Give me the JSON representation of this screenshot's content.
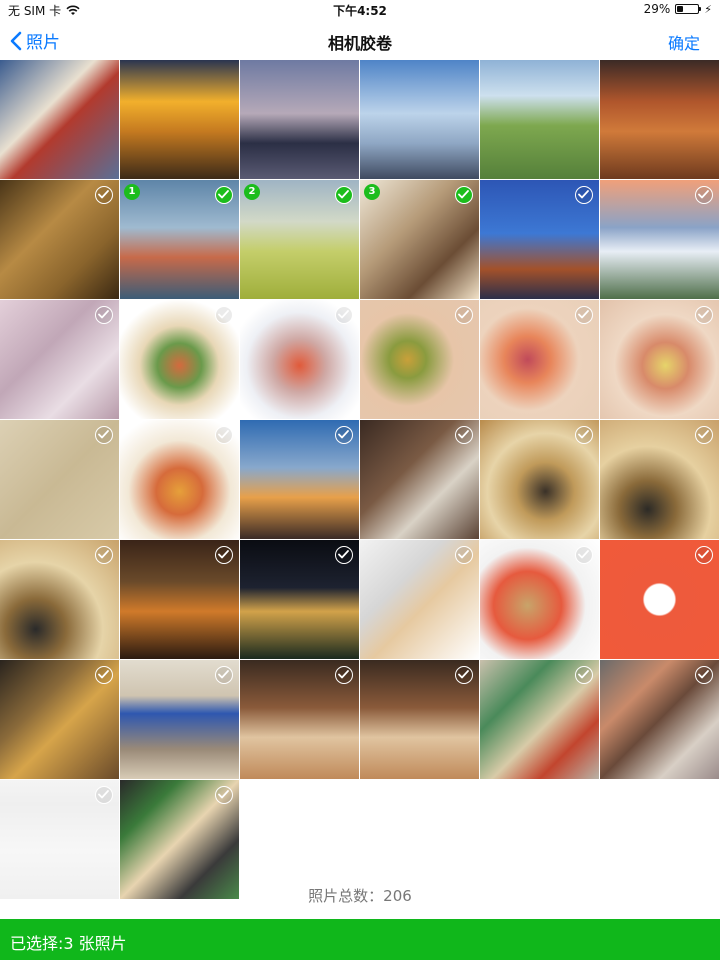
{
  "status": {
    "carrier": "无 SIM 卡",
    "time": "下午4:52",
    "battery": "29%",
    "battery_level": 0.29
  },
  "nav": {
    "back_label": "照片",
    "title": "相机胶卷",
    "confirm_label": "确定"
  },
  "summary": {
    "total_text": "照片总数：206"
  },
  "footer": {
    "selected_text": "已选择:3 张照片"
  },
  "selection": {
    "selected_color": "#1cbd1c",
    "accent_color": "#0a7aff"
  },
  "photos": [
    {
      "bg": "linear-gradient(135deg,#3b5c8f 0%,#e9e0d0 40%,#b23a2e 55%,#5a6f96 100%)",
      "check": false
    },
    {
      "bg": "linear-gradient(180deg,#2a3550 0%,#f2b02c 35%,#c57a20 60%,#3c2a18 100%)",
      "check": false
    },
    {
      "bg": "linear-gradient(180deg,#6e7aa2 0%,#b6a9b8 45%,#2b2f45 70%,#5a5a73 100%)",
      "check": false
    },
    {
      "bg": "linear-gradient(180deg,#4f84c7 0%,#bcd3ea 45%,#8fa7c4 70%,#3f4a60 100%)",
      "check": false
    },
    {
      "bg": "linear-gradient(180deg,#8fb2d6 0%,#cde0ee 30%,#7ea84f 55%,#55803a 100%)",
      "check": false
    },
    {
      "bg": "linear-gradient(180deg,#3b2a26 0%,#b0562c 35%,#d07a3a 60%,#6e3a1e 100%)",
      "check": false
    },
    {
      "bg": "linear-gradient(135deg,#4a3518 0%,#b78a44 40%,#8a642c 70%,#3a2812 100%)",
      "check": true,
      "on": false
    },
    {
      "bg": "linear-gradient(180deg,#5e85a8 0%,#9fbad0 40%,#c76a4a 65%,#3b5c77 100%)",
      "check": true,
      "on": true,
      "n": "1"
    },
    {
      "bg": "linear-gradient(180deg,#9fb4c4 0%,#d2d9c7 35%,#c4ce6a 60%,#9fae3b 100%)",
      "check": true,
      "on": true,
      "n": "2"
    },
    {
      "bg": "linear-gradient(135deg,#efe8d8 0%,#b59a78 40%,#6b4d35 70%,#f1e1c6 100%)",
      "check": true,
      "on": true,
      "n": "3"
    },
    {
      "bg": "linear-gradient(180deg,#2d56b5 0%,#3d78d4 45%,#a3512a 75%,#2c2f4a 100%)",
      "check": true,
      "on": false
    },
    {
      "bg": "linear-gradient(180deg,#f0a07a 0%,#8aa3c7 40%,#e8eef6 60%,#4f6f4a 100%)",
      "check": true,
      "on": false
    },
    {
      "bg": "linear-gradient(135deg,#e3cfd9 0%,#c1a7b7 40%,#e9dde4 70%,#b79aa9 100%)",
      "check": true,
      "on": false
    },
    {
      "bg": "radial-gradient(circle at 50% 55%,#d46a3e 0%,#6a9a4b 25%,#e8d7b6 45%,#ffffff 75%)",
      "check": true,
      "on": false
    },
    {
      "bg": "radial-gradient(circle at 50% 55%,#e05a3a 0%,#cfa8a4 30%,#eef0f5 60%,#ffffff 80%)",
      "check": true,
      "on": false
    },
    {
      "bg": "radial-gradient(circle at 40% 50%,#c9a03a 0%,#8a9b3f 20%,#e7c5a8 50%,#e5c7ae 100%)",
      "check": true,
      "on": false
    },
    {
      "bg": "radial-gradient(circle at 40% 50%,#c04a5a 0%,#e8855a 25%,#edd3bd 55%,#e8cfb8 100%)",
      "check": true,
      "on": false
    },
    {
      "bg": "radial-gradient(circle at 55% 55%,#e6d46a 0%,#d88a6a 25%,#efd8c4 55%,#e2c2aa 100%)",
      "check": true,
      "on": false
    },
    {
      "bg": "linear-gradient(135deg,#dcd0b4 0%,#c9b994 50%,#d8caa8 100%)",
      "check": true,
      "on": false
    },
    {
      "bg": "radial-gradient(circle at 50% 60%,#e6a03a 0%,#d66b3b 25%,#f2e8d6 55%,#ffffff 85%)",
      "check": true,
      "on": false
    },
    {
      "bg": "linear-gradient(180deg,#2f6bb2 0%,#88a8cc 40%,#e8a04a 65%,#3a2a26 100%)",
      "check": true,
      "on": false
    },
    {
      "bg": "linear-gradient(135deg,#3a2a22 0%,#7a5a44 40%,#d9d2c6 65%,#5a4234 100%)",
      "check": true,
      "on": false
    },
    {
      "bg": "radial-gradient(circle at 55% 60%,#3a3128 0%,#c09a5a 30%,#e7d4a8 60%,#b88a4a 100%)",
      "check": true,
      "on": false
    },
    {
      "bg": "radial-gradient(circle at 40% 75%,#2c2a26 0%,#8a6a3a 25%,#e6d0a0 55%,#c8a06a 100%)",
      "check": true,
      "on": false
    },
    {
      "bg": "radial-gradient(circle at 30% 75%,#2a2a2a 0%,#8a6a3a 25%,#e6d4a8 55%,#c8a26a 100%)",
      "check": true,
      "on": false
    },
    {
      "bg": "linear-gradient(180deg,#3a2418 0%,#6a4a2a 35%,#d07a2a 60%,#2a1a10 100%)",
      "check": true,
      "on": false
    },
    {
      "bg": "linear-gradient(180deg,#0a0c12 0%,#1d2230 40%,#d2a24a 60%,#1a2a1e 100%)",
      "check": true,
      "on": false
    },
    {
      "bg": "linear-gradient(135deg,#f2f2f2 0%,#d6d6d6 35%,#e6c9a0 55%,#ffffff 100%)",
      "check": true,
      "on": false
    },
    {
      "bg": "radial-gradient(circle at 40% 55%,#c8a46a 0%,#e65a3e 35%,#f2f2f2 60%,#ffffff 100%)",
      "check": true,
      "on": false
    },
    {
      "bg": "radial-gradient(circle at 50% 50%,#ffffff 0%,#ffffff 18%,#ee5a3c 20%,#f05a3a 100%)",
      "check": true,
      "on": false
    },
    {
      "bg": "linear-gradient(135deg,#2a241e 0%,#8a6a3a 35%,#d6a44a 55%,#6a4a2a 100%)",
      "check": true,
      "on": false
    },
    {
      "bg": "linear-gradient(180deg,#e2dccf 0%,#cfc4b0 30%,#2e57b0 45%,#9a8a78 75%,#d8ccb6 100%)",
      "check": true,
      "on": false
    },
    {
      "bg": "linear-gradient(180deg,#3a2a20 0%,#8a5a3a 40%,#e0c4a0 65%,#c08a5a 100%)",
      "check": true,
      "on": false
    },
    {
      "bg": "linear-gradient(180deg,#3a2a20 0%,#8a5a3a 40%,#e0c4a0 65%,#c08a5a 100%)",
      "check": true,
      "on": false
    },
    {
      "bg": "linear-gradient(135deg,#c9c0ac 0%,#4a8a5a 30%,#d8cba8 55%,#c2452e 75%,#b9b3a6 100%)",
      "check": true,
      "on": false
    },
    {
      "bg": "linear-gradient(135deg,#6a6a6a 0%,#c98a6a 30%,#6a4a3a 50%,#d8cfc5 75%,#9a8b8a 100%)",
      "check": true,
      "on": false
    },
    {
      "bg": "linear-gradient(180deg,#f4f4f4 0%,#efefef 20%,#f7f7f7 60%,#f0f0f0 100%)",
      "check": true,
      "on": false
    },
    {
      "bg": "linear-gradient(135deg,#2a2a2a 0%,#3a7a3a 25%,#e8d4b0 50%,#3a3a3a 75%,#4a8a4a 100%)",
      "check": true,
      "on": false
    }
  ]
}
